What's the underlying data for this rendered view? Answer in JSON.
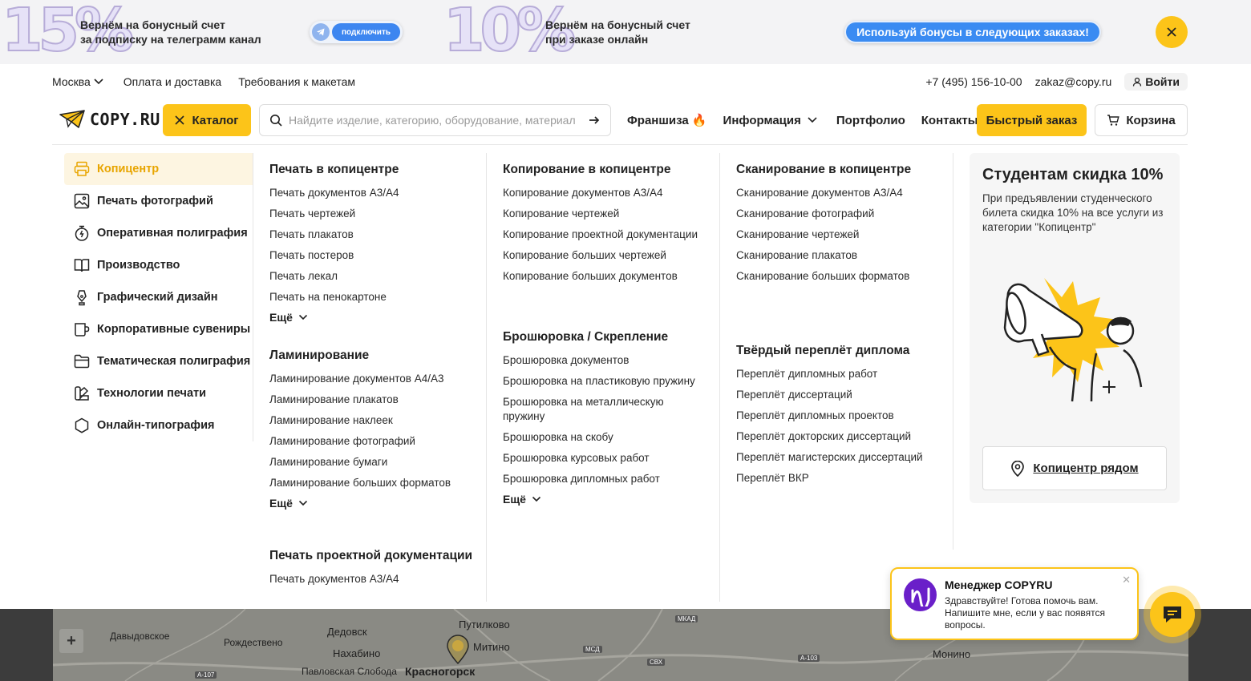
{
  "promo": {
    "left_percent": "15%",
    "left_text_1": "Вернём на бонусный счет",
    "left_text_2": "за подписку на телеграмм канал",
    "connect_label": "подключить",
    "right_percent": "10%",
    "right_text_1": "Вернём на бонусный счет",
    "right_text_2": "при заказе онлайн",
    "bonus_label": "Используй бонусы в следующих заказах!"
  },
  "topline": {
    "city": "Москва",
    "links": [
      "Оплата и доставка",
      "Требования к макетам"
    ],
    "phone": "+7 (495) 156-10-00",
    "email": "zakaz@copy.ru",
    "login": "Войти"
  },
  "header": {
    "logo": "COPY.RU",
    "catalog_label": "Каталог",
    "search_placeholder": "Найдите изделие, категорию, оборудование, материал",
    "nav": [
      "Франшиза 🔥",
      "Информация",
      "Портфолио",
      "Контакты"
    ],
    "quick_order": "Быстрый заказ",
    "cart": "Корзина"
  },
  "sidebar": {
    "items": [
      {
        "label": "Копицентр",
        "icon": "printer-icon"
      },
      {
        "label": "Печать фотографий",
        "icon": "photo-icon"
      },
      {
        "label": "Оперативная полиграфия",
        "icon": "stopwatch-icon"
      },
      {
        "label": "Производство",
        "icon": "book-icon"
      },
      {
        "label": "Графический дизайн",
        "icon": "pen-nib-icon"
      },
      {
        "label": "Корпоративные сувениры",
        "icon": "mug-icon"
      },
      {
        "label": "Тематическая полиграфия",
        "icon": "folder-icon"
      },
      {
        "label": "Технологии печати",
        "icon": "palette-icon"
      },
      {
        "label": "Онлайн-типография",
        "icon": "hexagon-icon"
      }
    ]
  },
  "columns": {
    "c1": [
      {
        "title": "Печать в копицентре",
        "links": [
          "Печать документов А3/А4",
          "Печать чертежей",
          "Печать плакатов",
          "Печать постеров",
          "Печать лекал",
          "Печать на пенокартоне"
        ],
        "more": "Ещё"
      },
      {
        "title": "Ламинирование",
        "links": [
          "Ламинирование документов А4/А3",
          "Ламинирование плакатов",
          "Ламинирование наклеек",
          "Ламинирование фотографий",
          "Ламинирование бумаги",
          "Ламинирование больших форматов"
        ],
        "more": "Ещё"
      },
      {
        "title": "Печать проектной документации",
        "links": [
          "Печать документов А3/А4"
        ],
        "more": ""
      }
    ],
    "c2": [
      {
        "title": "Копирование в копицентре",
        "links": [
          "Копирование документов А3/А4",
          "Копирование чертежей",
          "Копирование проектной документации",
          "Копирование больших чертежей",
          "Копирование больших документов"
        ],
        "more": ""
      },
      {
        "title": "Брошюровка / Скрепление",
        "links": [
          "Брошюровка документов",
          "Брошюровка на пластиковую пружину",
          "Брошюровка на металлическую пружину",
          "Брошюровка на скобу",
          "Брошюровка курсовых работ",
          "Брошюровка дипломных работ"
        ],
        "more": "Ещё"
      }
    ],
    "c3": [
      {
        "title": "Сканирование в копицентре",
        "links": [
          "Сканирование документов А3/А4",
          "Сканирование фотографий",
          "Сканирование чертежей",
          "Сканирование плакатов",
          "Сканирование больших форматов"
        ],
        "more": ""
      },
      {
        "title": "Твёрдый переплёт диплома",
        "links": [
          "Переплёт дипломных работ",
          "Переплёт диссертаций",
          "Переплёт дипломных проектов",
          "Переплёт докторских диссертаций",
          "Переплёт магистерских диссертаций",
          "Переплёт ВКР"
        ],
        "more": ""
      }
    ]
  },
  "promo_card": {
    "title": "Студентам скидка 10%",
    "text": "При предъявлении студенческого билета скидка 10% на все услуги из категории \"Копицентр\"",
    "button": "Копицентр рядом"
  },
  "map": {
    "labels": [
      "Давыдовское",
      "Рождествено",
      "Дедовск",
      "Путилково",
      "Нахабино",
      "Митино",
      "Павловская Слобода",
      "Красногорск",
      "Монино"
    ],
    "roads": [
      "А-107",
      "А-103",
      "МКАД",
      "МСД",
      "СВХ"
    ]
  },
  "chat": {
    "title": "Менеджер COPYRU",
    "text": "Здравствуйте! Готова помочь вам. Напишите мне, если у вас появятся вопросы."
  },
  "colors": {
    "accent": "#fcc419",
    "accent_text": "#e8a500",
    "promo_blue": "#3a8bf2",
    "chat_avatar": "#6a1fc9"
  }
}
